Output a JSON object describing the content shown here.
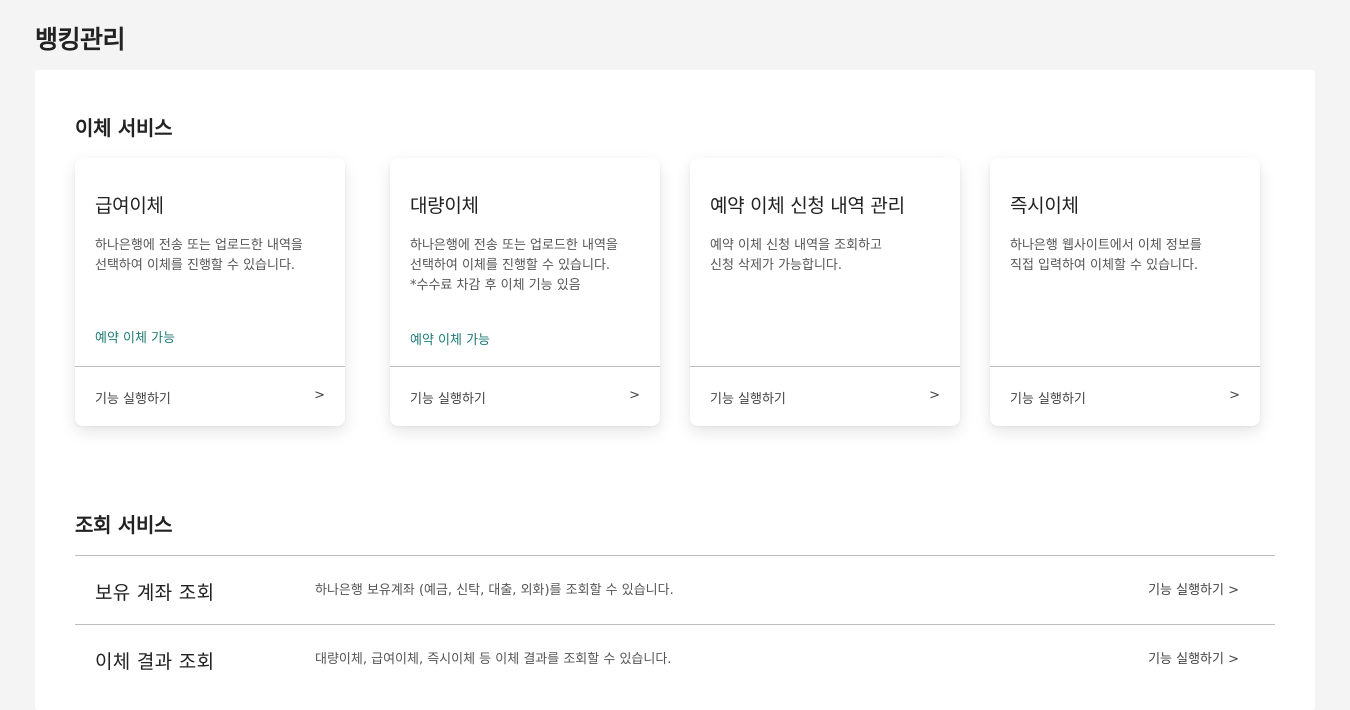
{
  "page": {
    "title": "뱅킹관리"
  },
  "transfer_section": {
    "title": "이체 서비스",
    "cards": [
      {
        "title": "급여이체",
        "description": "하나은행에 전송 또는 업로드한 내역을\n선택하여 이체를 진행할 수 있습니다.",
        "tag": "예약 이체 가능",
        "action_label": "기능 실행하기",
        "arrow": ">"
      },
      {
        "title": "대량이체",
        "description": "하나은행에 전송 또는 업로드한 내역을\n선택하여 이체를 진행할 수 있습니다.\n*수수료 차감 후 이체 기능 있음",
        "tag": "예약 이체 가능",
        "action_label": "기능 실행하기",
        "arrow": ">"
      },
      {
        "title": "예약 이체 신청 내역 관리",
        "description": "예약 이체 신청 내역을 조회하고\n신청 삭제가 가능합니다.",
        "tag": "",
        "action_label": "기능 실행하기",
        "arrow": ">"
      },
      {
        "title": "즉시이체",
        "description": "하나은행 웹사이트에서 이체 정보를\n직접 입력하여 이체할 수 있습니다.",
        "tag": "",
        "action_label": "기능 실행하기",
        "arrow": ">"
      }
    ]
  },
  "inquiry_section": {
    "title": "조회 서비스",
    "rows": [
      {
        "title": "보유 계좌 조회",
        "description": "하나은행 보유계좌 (예금, 신탁, 대출, 외화)를 조회할 수 있습니다.",
        "action_label": "기능 실행하기 >"
      },
      {
        "title": "이체 결과 조회",
        "description": "대량이체, 급여이체, 즉시이체 등 이체 결과를 조회할 수 있습니다.",
        "action_label": "기능 실행하기 >"
      }
    ]
  },
  "colors": {
    "background": "#f4f4f4",
    "panel": "#ffffff",
    "accent_tag": "#1e7a74",
    "divider": "#bdbdbd"
  }
}
